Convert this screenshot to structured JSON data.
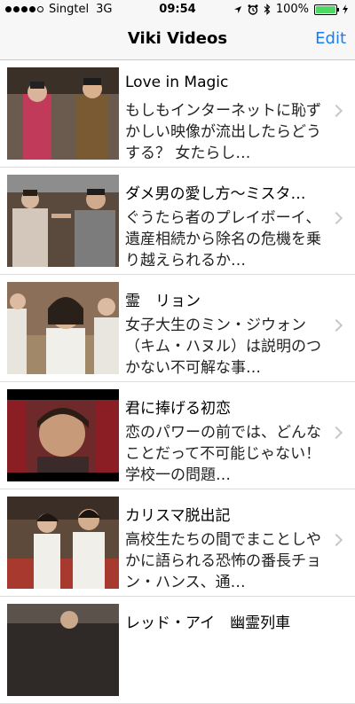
{
  "status": {
    "carrier": "Singtel",
    "network": "3G",
    "time": "09:54",
    "battery": "100%",
    "battery_color": "#4cd964"
  },
  "nav": {
    "title": "Viki Videos",
    "edit_label": "Edit",
    "accent_color": "#1a7cf5"
  },
  "videos": [
    {
      "title": "Love in Magic",
      "description": "もしもインターネットに恥ずかしい映像が流出したらどうする？ 女たらし…"
    },
    {
      "title": "ダメ男の愛し方～ミスタ…",
      "description": "ぐうたら者のプレイボーイ、遺産相続から除名の危機を乗り越えられるか…"
    },
    {
      "title": "霊　リョン",
      "description": "女子大生のミン・ジウォン（キム・ハヌル）は説明のつかない不可解な事…"
    },
    {
      "title": "君に捧げる初恋",
      "description": "恋のパワーの前では、どんなことだって不可能じゃない！ 学校一の問題…"
    },
    {
      "title": "カリスマ脱出記",
      "description": "高校生たちの間でまことしやかに語られる恐怖の番長チョン・ハンス、通…"
    },
    {
      "title": "レッド・アイ　幽霊列車",
      "description": ""
    }
  ]
}
